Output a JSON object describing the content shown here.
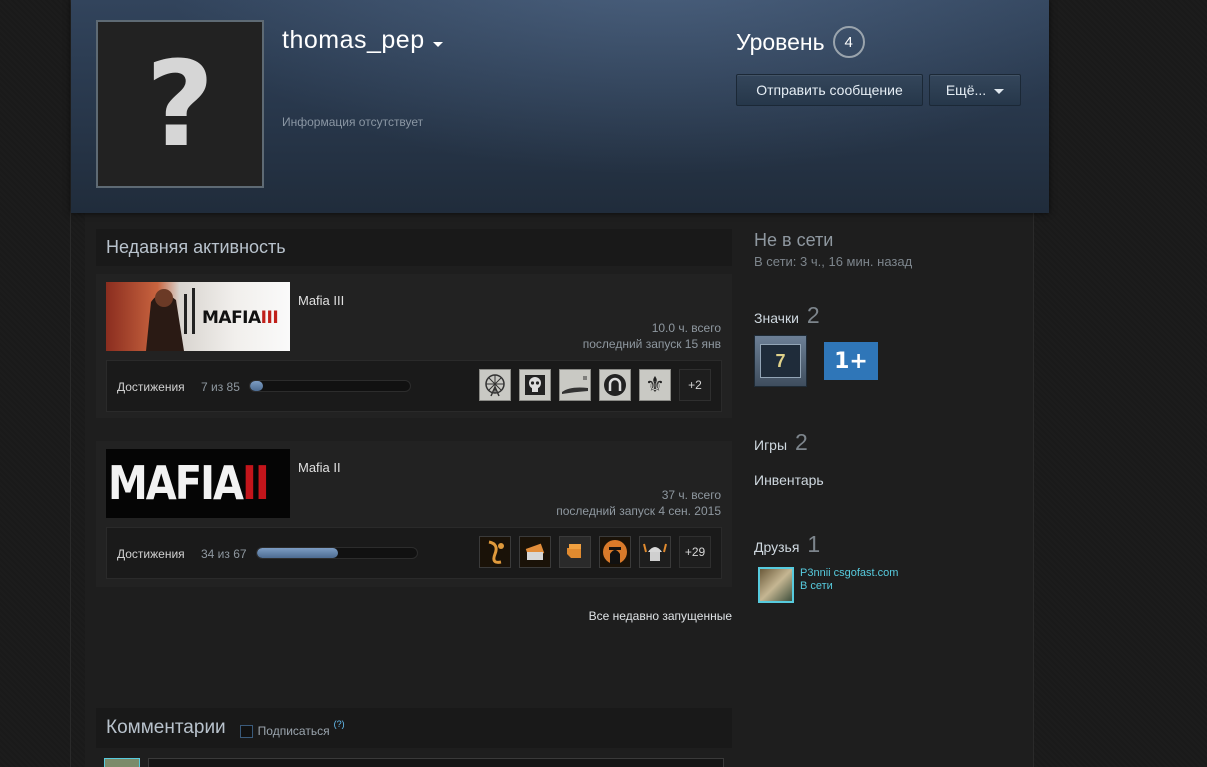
{
  "profile": {
    "username": "thomas_pep",
    "no_info": "Информация отсутствует",
    "avatar_placeholder": "?",
    "level_label": "Уровень",
    "level_value": "4",
    "send_message": "Отправить сообщение",
    "more": "Ещё..."
  },
  "activity": {
    "title": "Недавняя активность",
    "games": [
      {
        "name": "Mafia III",
        "hours": "10.0 ч. всего",
        "last_played": "последний запуск 15 янв",
        "ach_label": "Достижения",
        "ach_count": "7 из 85",
        "ach_progress": 0.082,
        "ach_more": "+2",
        "logo_text": "MAFIA",
        "logo_suffix": "III"
      },
      {
        "name": "Mafia II",
        "hours": "37 ч. всего",
        "last_played": "последний запуск 4 сен. 2015",
        "ach_label": "Достижения",
        "ach_count": "34 из 67",
        "ach_progress": 0.507,
        "ach_more": "+29",
        "logo_text": "MAFIA",
        "logo_suffix": "II"
      }
    ],
    "all_recent": "Все недавно запущенные"
  },
  "sidebar": {
    "status_title": "Не в сети",
    "status_sub": "В сети: 3 ч., 16 мин. назад",
    "badges_label": "Значки",
    "badges_count": "2",
    "badge1_text": "7",
    "badge2_text": "1+",
    "games_label": "Игры",
    "games_count": "2",
    "inventory": "Инвентарь",
    "friends_label": "Друзья",
    "friends_count": "1",
    "friend_name": "P3nnii csgofast.com",
    "friend_status": "В сети"
  },
  "comments": {
    "title": "Комментарии",
    "subscribe": "Подписаться",
    "help": "(?)"
  },
  "colors": {
    "accent": "#57cbde",
    "progress": "#6a8ab0",
    "header": "#2a3a4f"
  }
}
